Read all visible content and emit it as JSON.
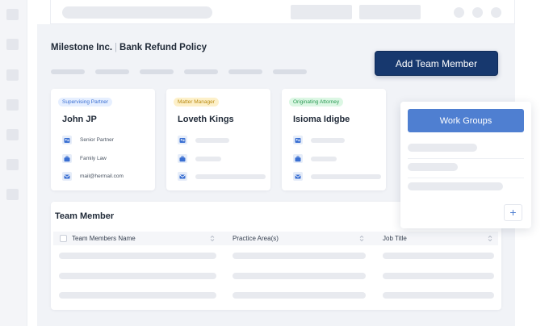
{
  "header": {
    "company": "Milestone Inc.",
    "separator": "|",
    "policy": "Bank Refund Policy"
  },
  "actions": {
    "add_team_member_label": "Add Team Member"
  },
  "cards": [
    {
      "role": "Supervising Partner",
      "name": "John JP",
      "title": "Senior Partner",
      "practice": "Family Law",
      "email": "mail@hermail.com"
    },
    {
      "role": "Matter Manager",
      "name": "Loveth Kings"
    },
    {
      "role": "Originating Attorney",
      "name": "Isioma Idigbe"
    }
  ],
  "table": {
    "title": "Team Member",
    "columns": [
      "Team Members Name",
      "Practice Area(s)",
      "Job Title"
    ]
  },
  "work_groups": {
    "title": "Work Groups",
    "add_symbol": "+"
  },
  "colors": {
    "primary_button": "#17386e",
    "work_groups_header": "#4f7fd1",
    "badge_supervising": "#3a6fd2",
    "badge_manager": "#b88a12",
    "badge_originating": "#2c9b55"
  },
  "icons": [
    "contact-card-icon",
    "briefcase-icon",
    "mail-icon",
    "sort-icon",
    "plus-icon"
  ]
}
